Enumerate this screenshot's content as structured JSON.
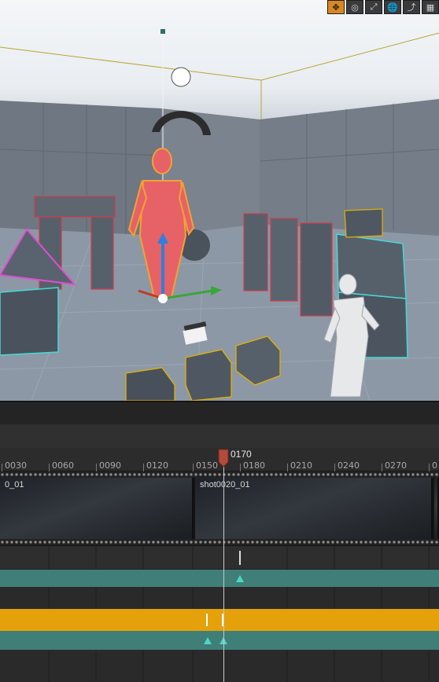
{
  "viewport": {
    "toolbar": [
      {
        "name": "translate-tool-icon",
        "glyph": "✥",
        "active": true
      },
      {
        "name": "rotate-tool-icon",
        "glyph": "◎",
        "active": false
      },
      {
        "name": "scale-tool-icon",
        "glyph": "⤢",
        "active": false
      },
      {
        "name": "world-space-icon",
        "glyph": "🌐",
        "active": false
      },
      {
        "name": "surface-snap-icon",
        "glyph": "⤴",
        "active": false
      },
      {
        "name": "grid-snap-icon",
        "glyph": "▦",
        "active": false
      }
    ]
  },
  "sequencer": {
    "playhead_frame": "0170",
    "ruler_ticks": [
      "0030",
      "0060",
      "0090",
      "0120",
      "0150",
      "0180",
      "0210",
      "0240",
      "0270",
      "0"
    ],
    "shots": [
      {
        "label": "0_01"
      },
      {
        "label": "shot0020_01"
      },
      {
        "label": ""
      }
    ]
  },
  "colors": {
    "accent": "#d8881e",
    "playhead": "#b44a3a",
    "teal_track": "#3f7f78",
    "gold_track": "#e5a10a",
    "key": "#4fd6c4"
  }
}
